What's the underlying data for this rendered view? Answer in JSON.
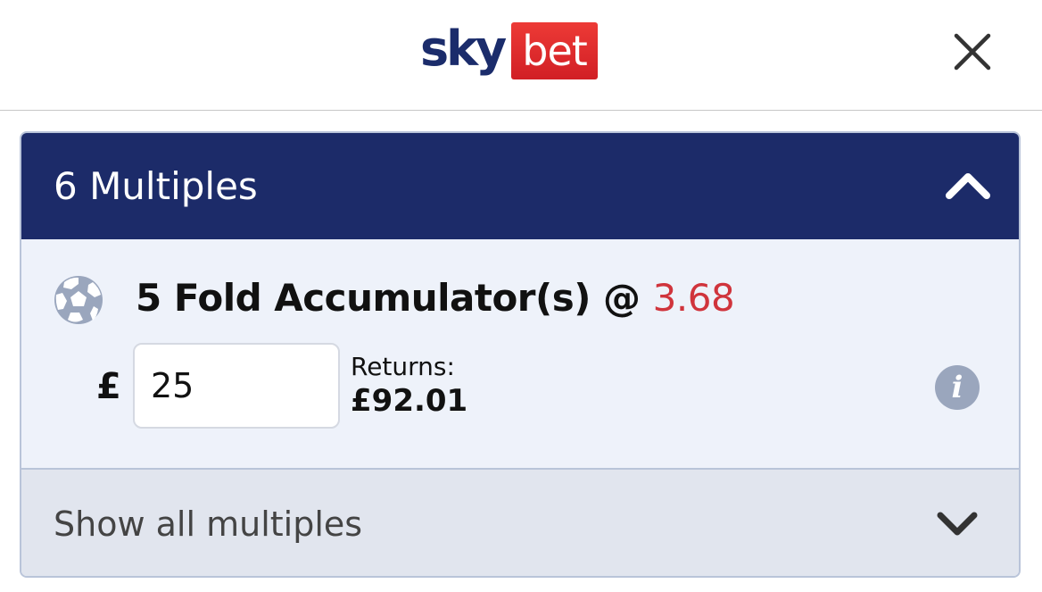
{
  "header": {
    "logo_part1": "sky",
    "logo_part2": "bet",
    "close_icon": "close-icon",
    "brand_blue": "#1b2c6b",
    "brand_red": "#e4252b"
  },
  "multiples": {
    "title": "6 Multiples",
    "collapse_icon": "chevron-up-icon",
    "header_bg": "#1c2b69"
  },
  "bet": {
    "sport_icon": "football-icon",
    "title": "5 Fold Accumulator(s) @ ",
    "odds": "3.68",
    "odds_color": "#d0343c",
    "currency": "£",
    "stake": "25",
    "returns_label": "Returns:",
    "returns_value": "£92.01",
    "info_icon": "info-icon",
    "info_text": "i"
  },
  "footer": {
    "show_all_label": "Show all multiples",
    "expand_icon": "chevron-down-icon"
  }
}
